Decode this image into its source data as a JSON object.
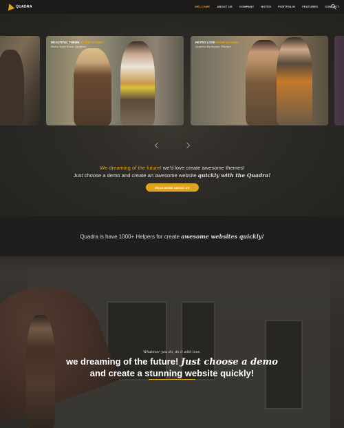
{
  "header": {
    "logo_text": "QUADRA",
    "nav": [
      "WELCOME",
      "ABOUT US",
      "COMPANY",
      "NOTES",
      "PORTFOLIO",
      "FEATURES",
      "CONTACT"
    ],
    "active_nav": "WELCOME"
  },
  "slider": {
    "cards": [
      {
        "title_plain": "BEAUTIFUL THEME ",
        "title_highlight": "AT THE STREET",
        "subtitle": "Retro Lost From Quadra!"
      },
      {
        "title_plain": "RETRO LOVE ",
        "title_highlight": "FROM QUADRA",
        "subtitle": "Quadra Exclusive Theme!"
      }
    ]
  },
  "intro": {
    "line1_highlight": "We dreaming of the future!",
    "line1_rest": " we'd love create awesome themes!",
    "line2_plain": "Just choose a demo and create an awesome website ",
    "line2_emph": "quickly with the Quadra!",
    "button_label": "READ MORE ABOUT US"
  },
  "helpers": {
    "text_plain": "Quadra is have 1000+ Helpers for create ",
    "text_emph": "awesome websites quickly!"
  },
  "hero": {
    "small": "Whatever you do, do it with love.",
    "title_line1_plain": "we dreaming of the future! ",
    "title_line1_emph": "Just choose a demo",
    "title_line2": "and create a stunning website quickly!"
  },
  "colors": {
    "accent": "#e0a520",
    "dark": "#1f1e1c"
  },
  "icons": {
    "search": "search-icon",
    "logo": "logo-icon",
    "prev": "chevron-left-icon",
    "next": "chevron-right-icon"
  }
}
